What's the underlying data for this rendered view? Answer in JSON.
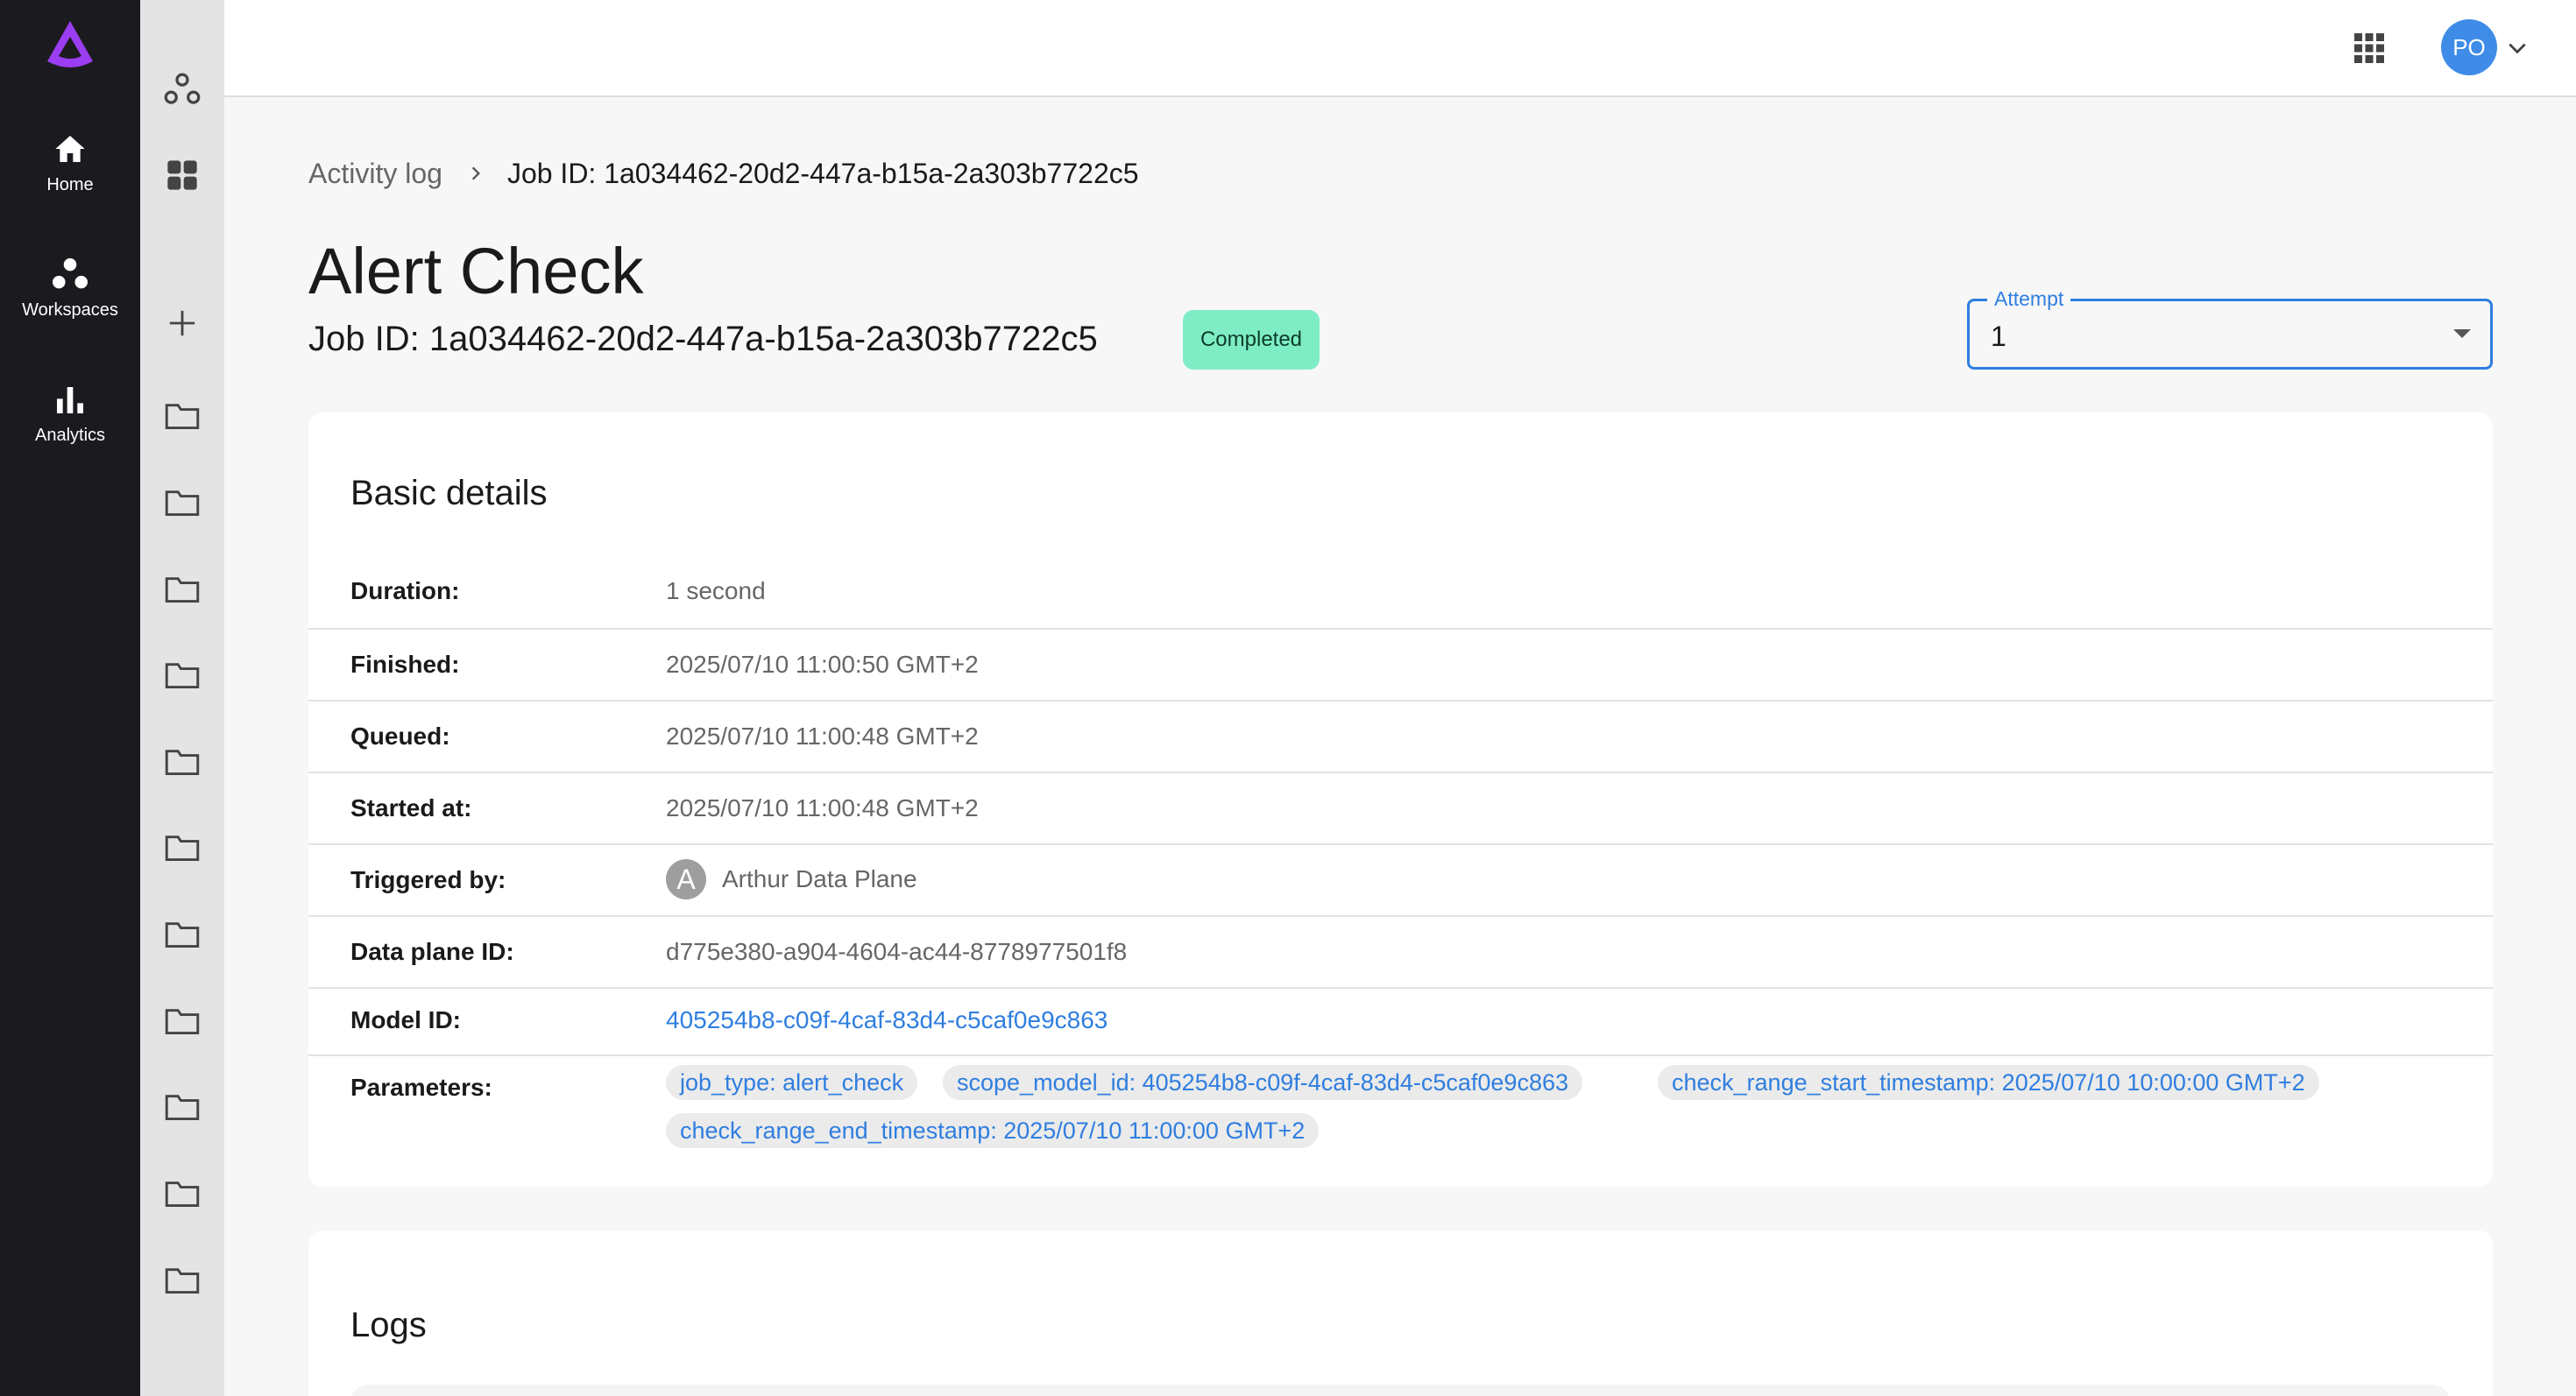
{
  "nav": {
    "items": [
      {
        "label": "Home",
        "icon": "home-icon"
      },
      {
        "label": "Workspaces",
        "icon": "workspaces-icon"
      },
      {
        "label": "Analytics",
        "icon": "analytics-icon"
      }
    ]
  },
  "user": {
    "initials": "PO"
  },
  "breadcrumb": {
    "parent": "Activity log",
    "current": "Job ID: 1a034462-20d2-447a-b15a-2a303b7722c5"
  },
  "job": {
    "title": "Alert Check",
    "id_line": "Job ID: 1a034462-20d2-447a-b15a-2a303b7722c5",
    "status": "Completed"
  },
  "attempt": {
    "label": "Attempt",
    "value": "1"
  },
  "details": {
    "heading": "Basic details",
    "duration_label": "Duration:",
    "duration": "1 second",
    "finished_label": "Finished:",
    "finished": "2025/07/10 11:00:50 GMT+2",
    "queued_label": "Queued:",
    "queued": "2025/07/10 11:00:48 GMT+2",
    "started_label": "Started at:",
    "started": "2025/07/10 11:00:48 GMT+2",
    "triggered_label": "Triggered by:",
    "triggered_initial": "A",
    "triggered": "Arthur Data Plane",
    "dataplane_label": "Data plane ID:",
    "dataplane": "d775e380-a904-4604-ac44-8778977501f8",
    "model_label": "Model ID:",
    "model": "405254b8-c09f-4caf-83d4-c5caf0e9c863",
    "params_label": "Parameters:",
    "params": [
      "job_type: alert_check",
      "scope_model_id: 405254b8-c09f-4caf-83d4-c5caf0e9c863",
      "check_range_start_timestamp: 2025/07/10 10:00:00 GMT+2",
      "check_range_end_timestamp: 2025/07/10 11:00:00 GMT+2"
    ]
  },
  "logs": {
    "heading": "Logs"
  },
  "colors": {
    "accent": "#2f7ee0",
    "badge": "#7eedc5",
    "brand": "#9b3df0",
    "rail": "#1b1a1f"
  }
}
